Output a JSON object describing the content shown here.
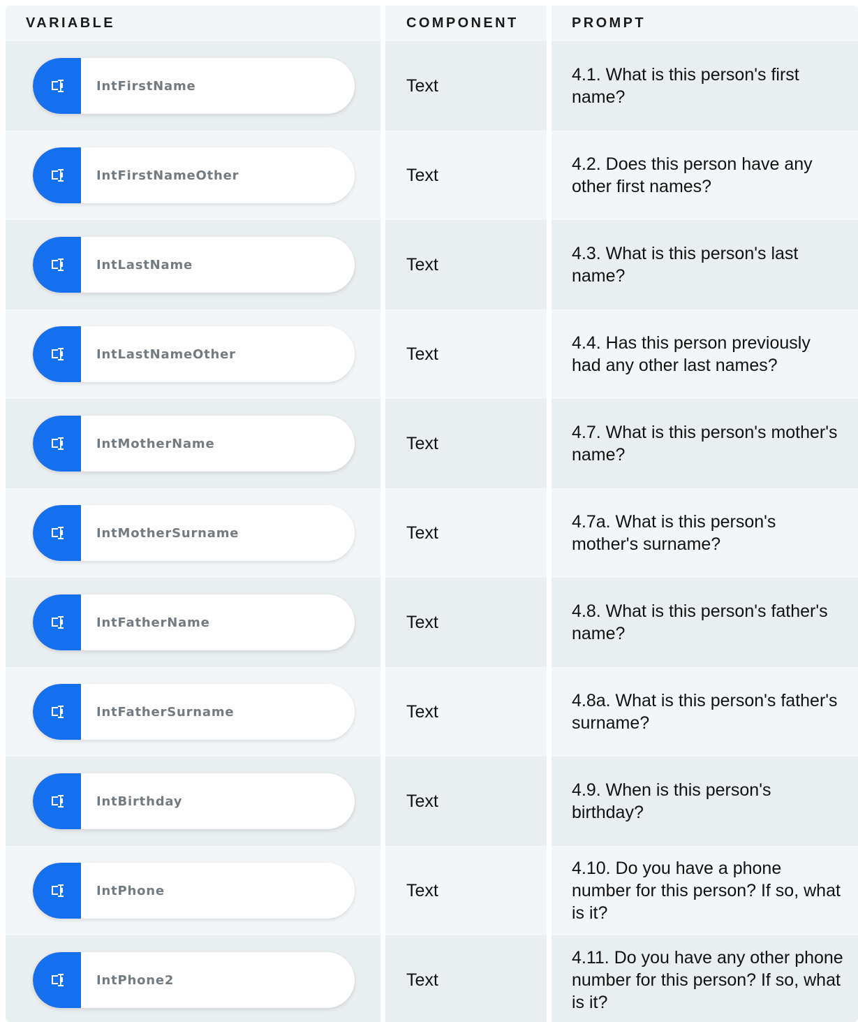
{
  "columns": {
    "variable": "VARIABLE",
    "component": "COMPONENT",
    "prompt": "PROMPT"
  },
  "icon": "text-field-icon",
  "accent_color": "#1570ef",
  "rows": [
    {
      "variable": "IntFirstName",
      "component": "Text",
      "prompt": "4.1. What is this person's first name?"
    },
    {
      "variable": "IntFirstNameOther",
      "component": "Text",
      "prompt": "4.2. Does this person have any other first names?"
    },
    {
      "variable": "IntLastName",
      "component": "Text",
      "prompt": "4.3. What is this person's last name?"
    },
    {
      "variable": "IntLastNameOther",
      "component": "Text",
      "prompt": "4.4. Has this person previously had any other last names?"
    },
    {
      "variable": "IntMotherName",
      "component": "Text",
      "prompt": "4.7. What is this person's mother's name?"
    },
    {
      "variable": "IntMotherSurname",
      "component": "Text",
      "prompt": "4.7a. What is this person's mother's surname?"
    },
    {
      "variable": "IntFatherName",
      "component": "Text",
      "prompt": "4.8. What is this person's father's name?"
    },
    {
      "variable": "IntFatherSurname",
      "component": "Text",
      "prompt": "4.8a. What is this person's father's surname?"
    },
    {
      "variable": "IntBirthday",
      "component": "Text",
      "prompt": "4.9. When is this person's birthday?"
    },
    {
      "variable": "IntPhone",
      "component": "Text",
      "prompt": "4.10. Do you have a phone number for this person? If so, what is it?"
    },
    {
      "variable": "IntPhone2",
      "component": "Text",
      "prompt": "4.11. Do you have any other phone number for this person? If so, what is it?"
    }
  ]
}
